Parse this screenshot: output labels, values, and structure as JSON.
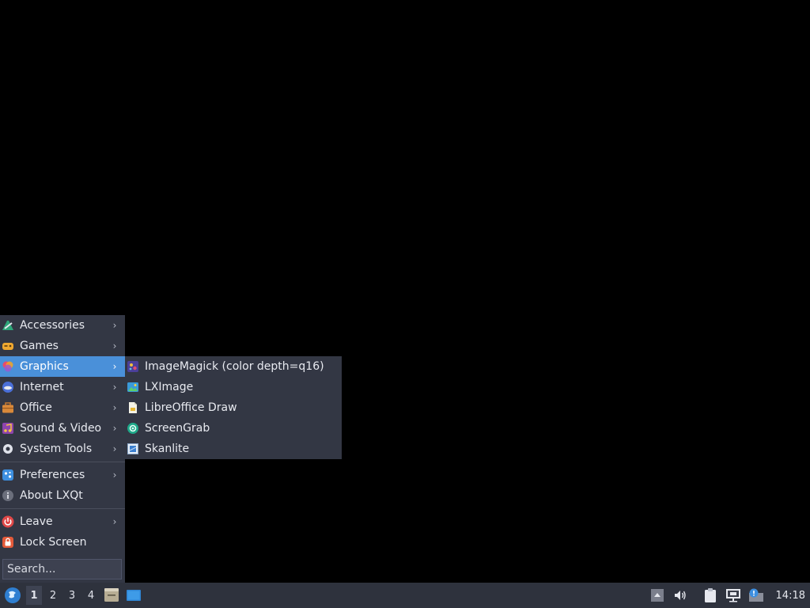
{
  "main_menu": {
    "items": [
      {
        "label": "Accessories",
        "icon": "accessories-icon",
        "submenu": true
      },
      {
        "label": "Games",
        "icon": "gamepad-icon",
        "submenu": true
      },
      {
        "label": "Graphics",
        "icon": "graphics-icon",
        "submenu": true,
        "active": true
      },
      {
        "label": "Internet",
        "icon": "globe-icon",
        "submenu": true
      },
      {
        "label": "Office",
        "icon": "briefcase-icon",
        "submenu": true
      },
      {
        "label": "Sound & Video",
        "icon": "multimedia-icon",
        "submenu": true
      },
      {
        "label": "System Tools",
        "icon": "system-tools-icon",
        "submenu": true
      }
    ],
    "items2": [
      {
        "label": "Preferences",
        "icon": "preferences-icon",
        "submenu": true
      },
      {
        "label": "About LXQt",
        "icon": "info-icon",
        "submenu": false
      }
    ],
    "items3": [
      {
        "label": "Leave",
        "icon": "power-icon",
        "submenu": true
      },
      {
        "label": "Lock Screen",
        "icon": "lock-icon",
        "submenu": false
      }
    ],
    "search_placeholder": "Search..."
  },
  "graphics_submenu": {
    "items": [
      {
        "label": "ImageMagick (color depth=q16)",
        "icon": "imagemagick-icon"
      },
      {
        "label": "LXImage",
        "icon": "image-viewer-icon"
      },
      {
        "label": "LibreOffice Draw",
        "icon": "libreoffice-draw-icon"
      },
      {
        "label": "ScreenGrab",
        "icon": "screengrab-icon"
      },
      {
        "label": "Skanlite",
        "icon": "scanner-icon"
      }
    ]
  },
  "taskbar": {
    "workspaces": [
      "1",
      "2",
      "3",
      "4"
    ],
    "current_workspace": "1",
    "clock": "14:18"
  },
  "colors": {
    "menu_bg": "#333744",
    "highlight": "#4a90d9",
    "taskbar_bg": "#2e323d",
    "desktop_bg": "#000000"
  }
}
